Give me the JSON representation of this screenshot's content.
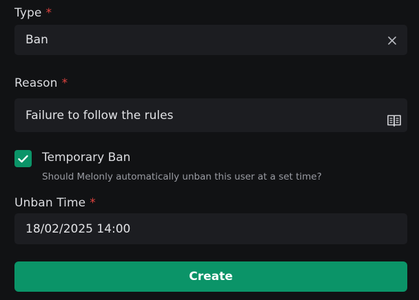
{
  "type_field": {
    "label": "Type",
    "required_mark": "*",
    "value": "Ban",
    "clear_icon": "close-icon"
  },
  "reason_field": {
    "label": "Reason",
    "required_mark": "*",
    "value": "Failure to follow the rules",
    "icon": "book-icon"
  },
  "temporary_ban": {
    "checked": true,
    "label": "Temporary Ban",
    "description": "Should Melonly automatically unban this user at a set time?"
  },
  "unban_time_field": {
    "label": "Unban Time",
    "required_mark": "*",
    "value": "18/02/2025 14:00"
  },
  "create_button": {
    "label": "Create"
  },
  "colors": {
    "background": "#111214",
    "field_bg": "#1c1d21",
    "accent": "#0b9468",
    "required": "#e0433f",
    "muted_text": "#9a9ca3"
  }
}
